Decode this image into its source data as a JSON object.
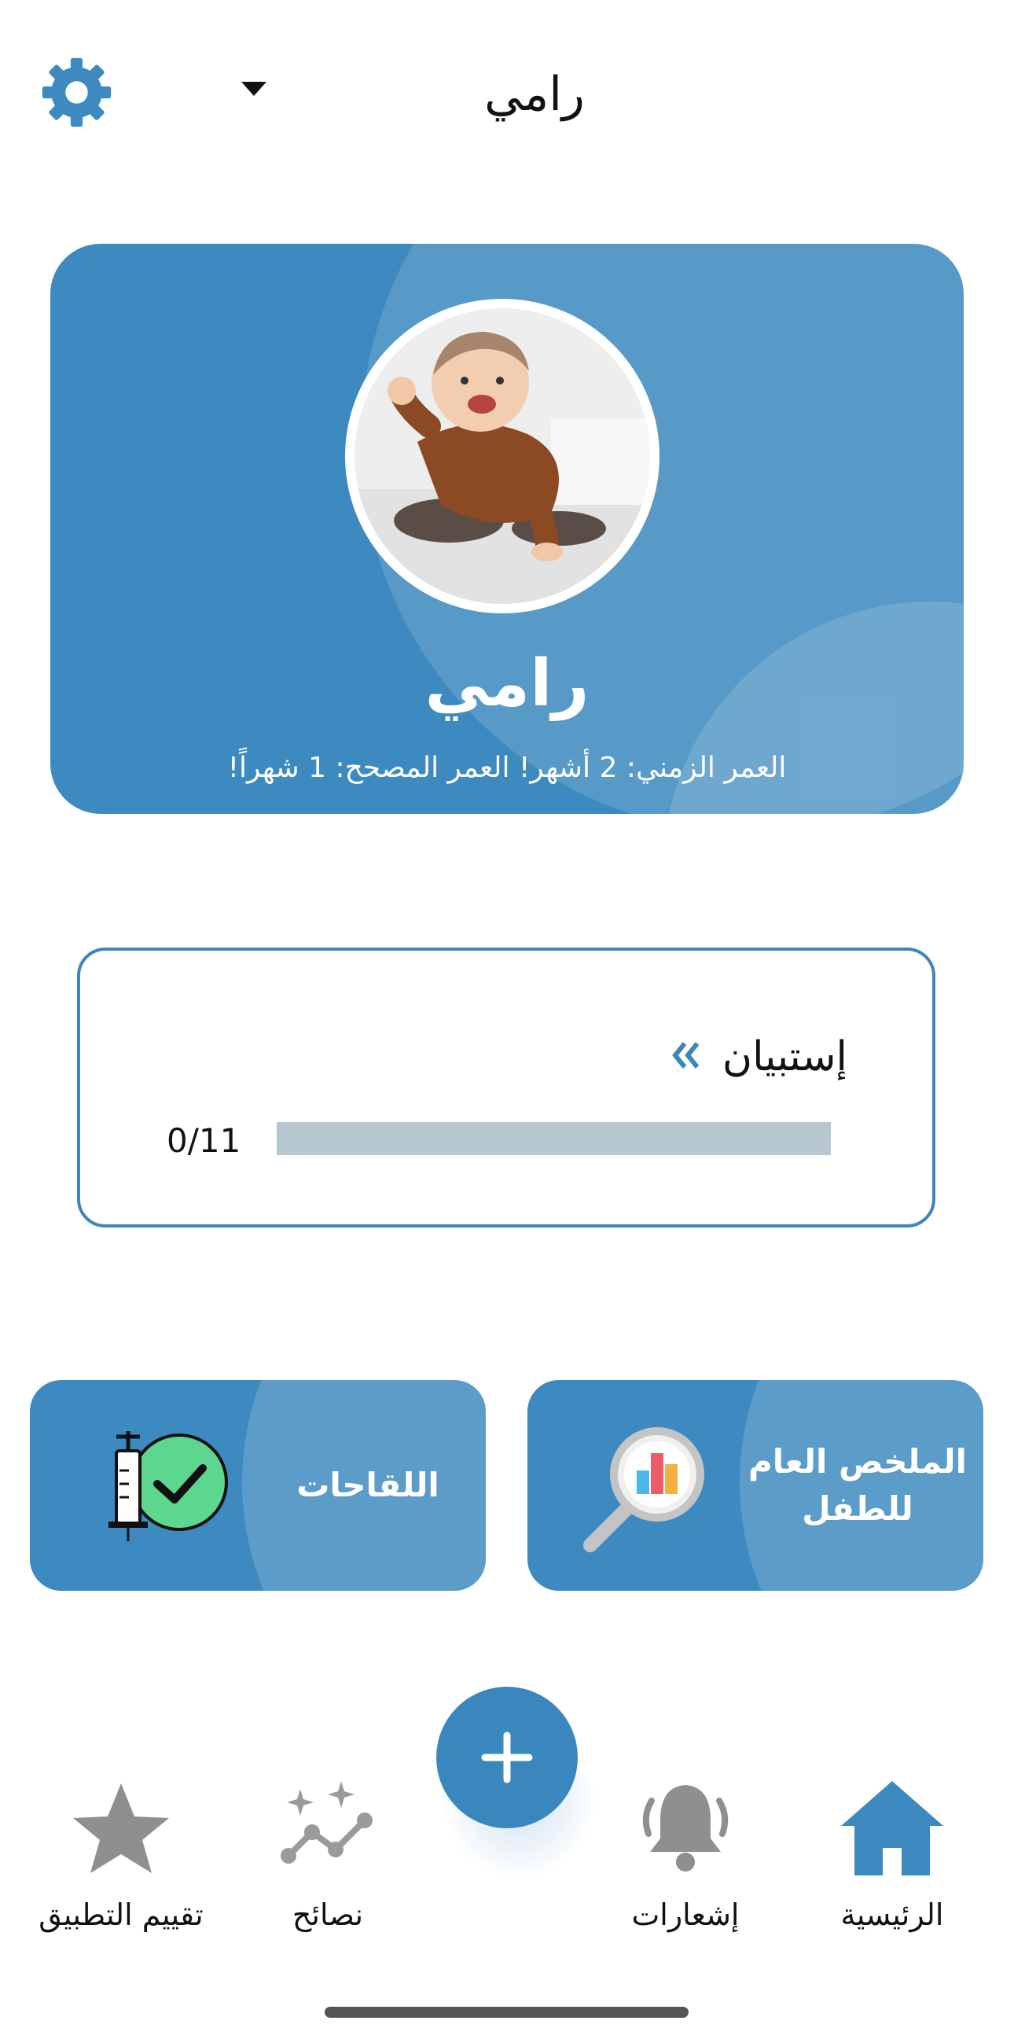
{
  "header": {
    "title": "رامي",
    "settings_icon": "gear-icon",
    "dropdown_icon": "caret-down-icon"
  },
  "profile": {
    "name": "رامي",
    "age_text": "العمر الزمني: 2 أشهر! العمر المصحح: 1 شهراً!",
    "avatar_icon": "child-photo"
  },
  "questionnaire": {
    "title": "إستبيان",
    "progress_text": "0/11",
    "progress_fraction": 0,
    "chevron_icon": "double-chevron-left-icon"
  },
  "tiles": {
    "vaccinations": {
      "label": "اللقاحات",
      "icon": "syringe-check-icon"
    },
    "summary": {
      "label_line1": "الملخص العام",
      "label_line2": "للطفل",
      "icon": "magnifier-chart-icon"
    }
  },
  "nav": {
    "home": "الرئيسية",
    "notifications": "إشعارات",
    "tips": "نصائح",
    "rate": "تقييم التطبيق",
    "add_icon": "plus-icon"
  },
  "colors": {
    "primary": "#3c8abf",
    "track": "#b7c7cf",
    "nav_inactive": "#8f8f8f",
    "check_green": "#5dd68f"
  }
}
